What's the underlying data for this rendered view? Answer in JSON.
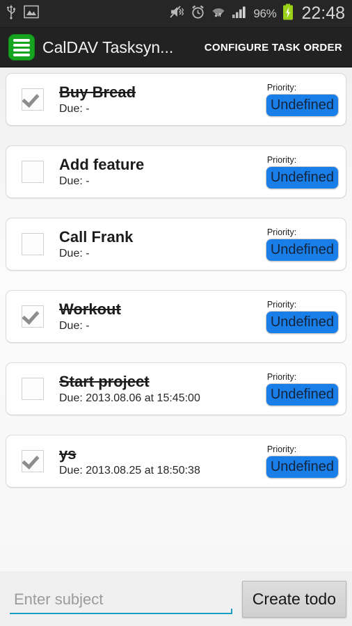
{
  "statusbar": {
    "left_icons": [
      "usb-icon",
      "image-icon"
    ],
    "right_icons": [
      "mute-vibrate-icon",
      "alarm-icon",
      "wifi-icon",
      "signal-icon"
    ],
    "battery_percent": "96%",
    "battery_state": "charging",
    "time": "22:48"
  },
  "actionbar": {
    "app_icon": "list-app-icon",
    "title": "CalDAV Tasksyn...",
    "action_label": "CONFIGURE TASK ORDER"
  },
  "colors": {
    "accent_blue": "#1a7ee8",
    "app_green": "#17a521",
    "underline_teal": "#1a9cc4",
    "actionbar_bg": "#222222",
    "statusbar_bg": "#262626"
  },
  "list": {
    "priority_label": "Priority:",
    "tasks": [
      {
        "title": "Buy Bread",
        "due": "Due: -",
        "checked": true,
        "struck": true,
        "priority": "Undefined"
      },
      {
        "title": "Add feature",
        "due": "Due: -",
        "checked": false,
        "struck": false,
        "priority": "Undefined"
      },
      {
        "title": "Call Frank",
        "due": "Due: -",
        "checked": false,
        "struck": false,
        "priority": "Undefined"
      },
      {
        "title": "Workout",
        "due": "Due: -",
        "checked": true,
        "struck": true,
        "priority": "Undefined"
      },
      {
        "title": "Start project",
        "due": "Due: 2013.08.06 at 15:45:00",
        "checked": false,
        "struck": true,
        "priority": "Undefined"
      },
      {
        "title": "ys",
        "due": "Due: 2013.08.25 at 18:50:38",
        "checked": true,
        "struck": true,
        "priority": "Undefined"
      }
    ]
  },
  "bottombar": {
    "subject_placeholder": "Enter subject",
    "subject_value": "",
    "create_label": "Create todo"
  }
}
